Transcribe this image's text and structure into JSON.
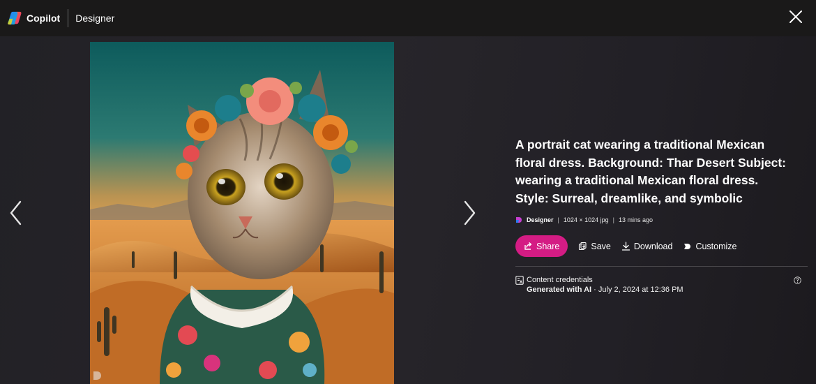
{
  "header": {
    "brand_name": "Copilot",
    "product_name": "Designer",
    "brand_icon": "copilot-logo-icon",
    "close_icon": "close-icon"
  },
  "viewer": {
    "prev_icon": "chevron-left-icon",
    "next_icon": "chevron-right-icon",
    "image_alt": "A portrait cat wearing a traditional Mexican floral dress in the Thar Desert",
    "watermark_icon": "designer-logo-icon"
  },
  "details": {
    "prompt": "A portrait cat wearing a traditional Mexican floral dress. Background: Thar Desert Subject: wearing a traditional Mexican floral dress. Style: Surreal, dreamlike, and symbolic",
    "meta": {
      "app": "Designer",
      "separator": "|",
      "dimensions": "1024 × 1024 jpg",
      "time": "13 mins ago"
    },
    "actions": {
      "share": "Share",
      "save": "Save",
      "download": "Download",
      "customize": "Customize"
    },
    "credentials": {
      "title": "Content credentials",
      "generated": "Generated with AI",
      "date": " · July 2, 2024 at 12:36 PM"
    }
  },
  "colors": {
    "share_accent": "#d41c84",
    "background": "#1c1b1f",
    "topbar": "#1a1919"
  }
}
